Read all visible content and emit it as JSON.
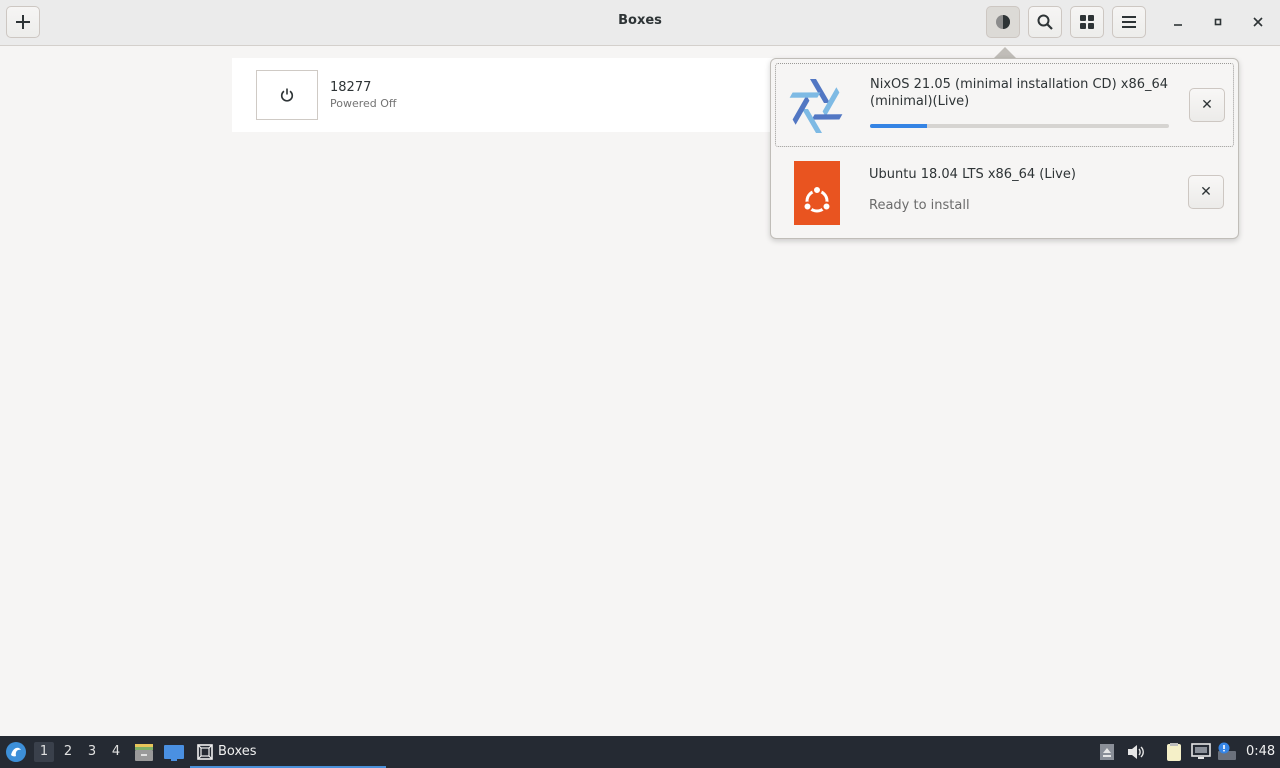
{
  "header": {
    "title": "Boxes",
    "new_icon": "plus-icon",
    "downloads_icon": "pie-progress-icon",
    "search_icon": "search-icon",
    "view_icon": "grid-view-icon",
    "menu_icon": "hamburger-menu-icon",
    "minimize_icon": "minimize-icon",
    "maximize_icon": "maximize-icon",
    "close_icon": "close-icon"
  },
  "boxes": [
    {
      "name": "18277",
      "status": "Powered Off",
      "icon": "power-icon"
    }
  ],
  "downloads": [
    {
      "title": "NixOS 21.05 (minimal installation CD) x86_64 (minimal)(Live)",
      "logo": "nixos-logo",
      "progress": 0.19,
      "close_label": "✕"
    },
    {
      "title": "Ubuntu 18.04 LTS x86_64 (Live)",
      "subtitle": "Ready to install",
      "logo": "ubuntu-logo",
      "close_label": "✕"
    }
  ],
  "taskbar": {
    "start_icon": "distro-menu-icon",
    "workspaces": [
      "1",
      "2",
      "3",
      "4"
    ],
    "active_workspace": "1",
    "launchers": [
      "file-manager-icon",
      "terminal-icon"
    ],
    "task_label": "Boxes",
    "task_icon": "boxes-app-icon",
    "tray": [
      "eject-icon",
      "volume-icon",
      "clipboard-icon",
      "network-icon",
      "notification-icon"
    ],
    "clock": "0:48"
  },
  "colors": {
    "accent": "#3584e4",
    "ubuntu": "#e95420",
    "taskbar": "#252a33"
  }
}
